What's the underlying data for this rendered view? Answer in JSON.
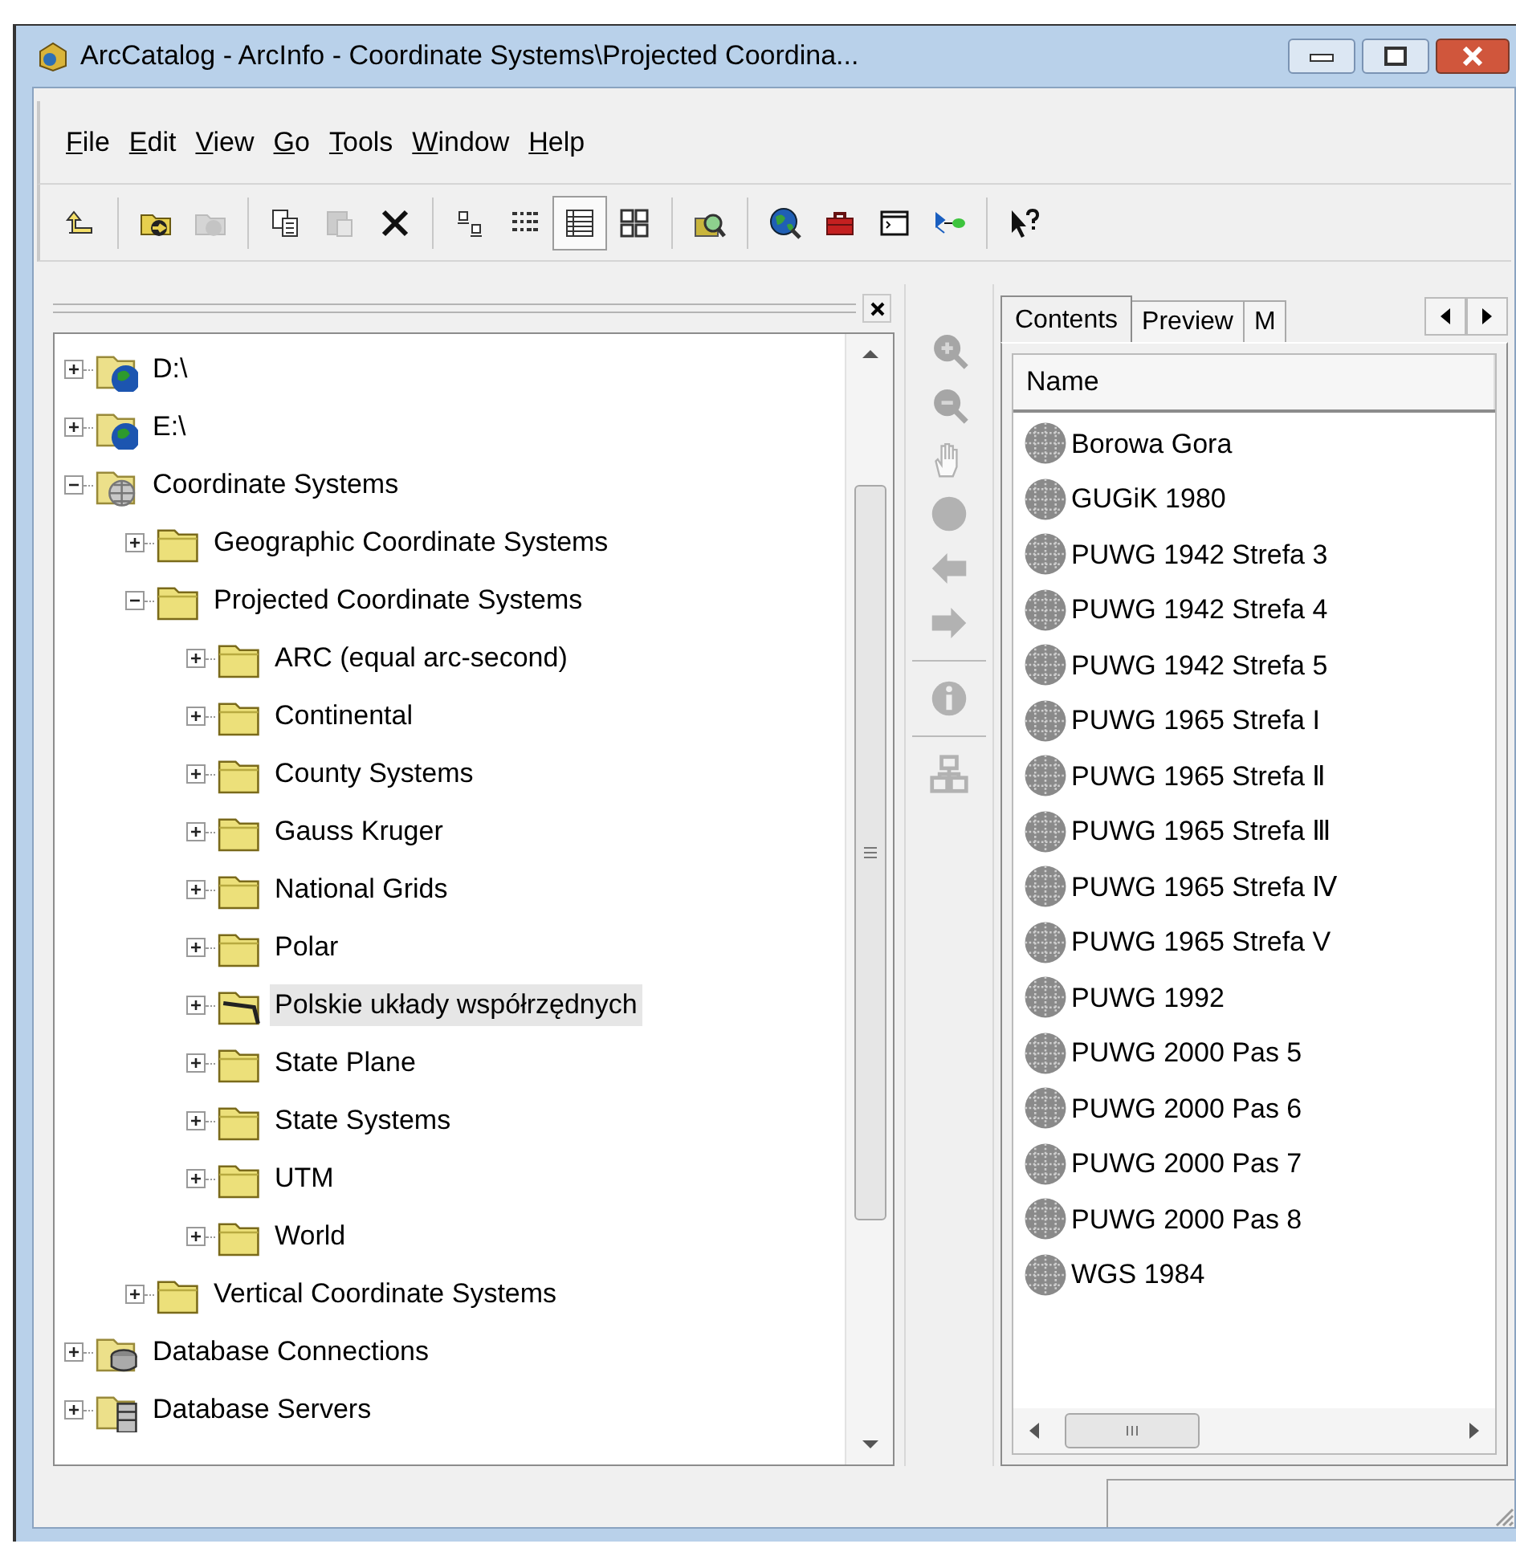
{
  "window": {
    "title": "ArcCatalog - ArcInfo - Coordinate Systems\\Projected Coordina..."
  },
  "menu": [
    "File",
    "Edit",
    "View",
    "Go",
    "Tools",
    "Window",
    "Help"
  ],
  "toolbar": {
    "groups": [
      [
        {
          "kind": "up",
          "disabled": false,
          "pressed": false
        }
      ],
      [
        {
          "kind": "connect",
          "disabled": false,
          "pressed": false
        },
        {
          "kind": "disconnect",
          "disabled": true,
          "pressed": false
        }
      ],
      [
        {
          "kind": "copy",
          "disabled": false,
          "pressed": false
        },
        {
          "kind": "paste",
          "disabled": true,
          "pressed": false
        },
        {
          "kind": "delete",
          "disabled": false,
          "pressed": false
        }
      ],
      [
        {
          "kind": "large-icons",
          "disabled": false,
          "pressed": false
        },
        {
          "kind": "list",
          "disabled": false,
          "pressed": false
        },
        {
          "kind": "details",
          "disabled": false,
          "pressed": true
        },
        {
          "kind": "thumbnails",
          "disabled": false,
          "pressed": false
        }
      ],
      [
        {
          "kind": "search",
          "disabled": false,
          "pressed": false
        }
      ],
      [
        {
          "kind": "globe",
          "disabled": false,
          "pressed": false
        },
        {
          "kind": "toolbox",
          "disabled": false,
          "pressed": false
        },
        {
          "kind": "command",
          "disabled": false,
          "pressed": false
        },
        {
          "kind": "model",
          "disabled": false,
          "pressed": false
        }
      ],
      [
        {
          "kind": "help",
          "disabled": false,
          "pressed": false
        }
      ]
    ]
  },
  "tree": {
    "items": [
      {
        "label": "D:\\",
        "kind": "drive",
        "expanded": false,
        "selected": false
      },
      {
        "label": "E:\\",
        "kind": "drive",
        "expanded": false,
        "selected": false
      },
      {
        "label": "Coordinate Systems",
        "kind": "catalog",
        "expanded": true,
        "selected": false,
        "children": [
          {
            "label": "Geographic Coordinate Systems",
            "kind": "folder",
            "expanded": false,
            "selected": false
          },
          {
            "label": "Projected Coordinate Systems",
            "kind": "folder",
            "expanded": true,
            "selected": false,
            "children": [
              {
                "label": "ARC (equal arc-second)",
                "kind": "folder",
                "expanded": false,
                "selected": false
              },
              {
                "label": "Continental",
                "kind": "folder",
                "expanded": false,
                "selected": false
              },
              {
                "label": "County Systems",
                "kind": "folder",
                "expanded": false,
                "selected": false
              },
              {
                "label": "Gauss Kruger",
                "kind": "folder",
                "expanded": false,
                "selected": false
              },
              {
                "label": "National Grids",
                "kind": "folder",
                "expanded": false,
                "selected": false
              },
              {
                "label": "Polar",
                "kind": "folder",
                "expanded": false,
                "selected": false
              },
              {
                "label": "Polskie układy współrzędnych",
                "kind": "linked-folder",
                "expanded": false,
                "selected": true
              },
              {
                "label": "State Plane",
                "kind": "folder",
                "expanded": false,
                "selected": false
              },
              {
                "label": "State Systems",
                "kind": "folder",
                "expanded": false,
                "selected": false
              },
              {
                "label": "UTM",
                "kind": "folder",
                "expanded": false,
                "selected": false
              },
              {
                "label": "World",
                "kind": "folder",
                "expanded": false,
                "selected": false
              }
            ]
          },
          {
            "label": "Vertical Coordinate Systems",
            "kind": "folder",
            "expanded": false,
            "selected": false
          }
        ]
      },
      {
        "label": "Database Connections",
        "kind": "connections",
        "expanded": false,
        "selected": false
      },
      {
        "label": "Database Servers",
        "kind": "servers",
        "expanded": false,
        "selected": false
      }
    ]
  },
  "map_tools": {
    "groups": [
      [
        {
          "kind": "zoom-in",
          "disabled": true
        },
        {
          "kind": "zoom-out",
          "disabled": true
        },
        {
          "kind": "pan",
          "disabled": true
        },
        {
          "kind": "full-extent",
          "disabled": true
        },
        {
          "kind": "back",
          "disabled": true
        },
        {
          "kind": "forward",
          "disabled": true
        }
      ],
      [
        {
          "kind": "identify",
          "disabled": true
        }
      ],
      [
        {
          "kind": "overview",
          "disabled": true
        }
      ]
    ]
  },
  "tabs": [
    {
      "label": "Contents",
      "selected": true
    },
    {
      "label": "Preview",
      "selected": false
    },
    {
      "label": "M",
      "selected": false
    }
  ],
  "contents": {
    "columns": [
      "Name"
    ],
    "rows": [
      "Borowa Gora",
      "GUGiK 1980",
      "PUWG 1942 Strefa 3",
      "PUWG 1942 Strefa 4",
      "PUWG 1942 Strefa 5",
      "PUWG 1965 Strefa I",
      "PUWG 1965 Strefa Ⅱ",
      "PUWG 1965 Strefa Ⅲ",
      "PUWG 1965 Strefa Ⅳ",
      "PUWG 1965 Strefa V",
      "PUWG 1992",
      "PUWG 2000 Pas 5",
      "PUWG 2000 Pas 6",
      "PUWG 2000 Pas 7",
      "PUWG 2000 Pas 8",
      "WGS 1984"
    ]
  }
}
